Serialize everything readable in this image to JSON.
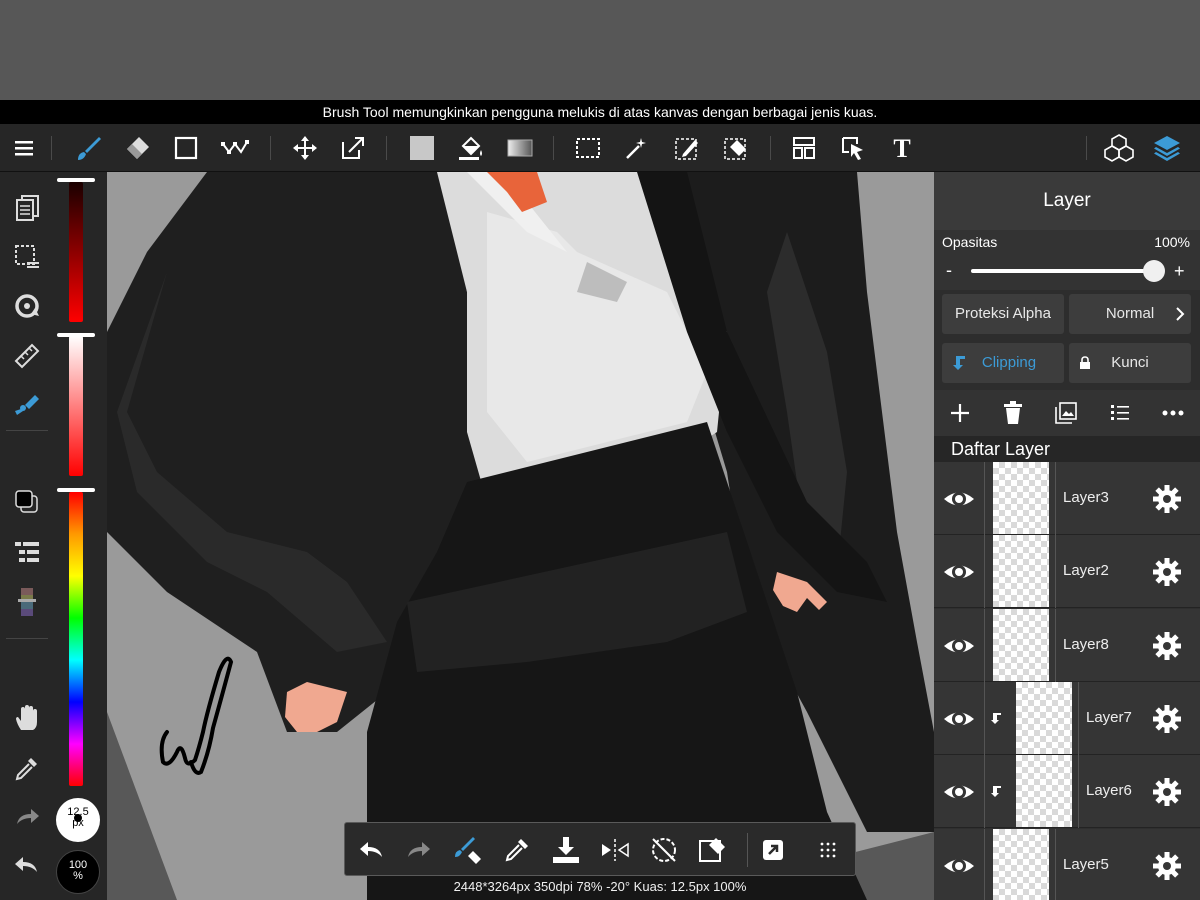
{
  "caption": "Brush Tool memungkinkan pengguna melukis di atas kanvas dengan berbagai jenis kuas.",
  "toolbar": {
    "tools": [
      "menu-icon",
      "brush-icon",
      "eraser-icon",
      "select-rect-icon",
      "lasso-icon",
      "move-icon",
      "transform-icon",
      "fill-color-icon",
      "bucket-icon",
      "gradient-icon",
      "marquee-icon",
      "magic-wand-icon",
      "select-pen-icon",
      "select-eraser-icon",
      "layout-icon",
      "select-layer-icon",
      "text-icon",
      "materials-icon",
      "layers-icon"
    ]
  },
  "brush_size": {
    "value": "12.5",
    "unit": "px"
  },
  "brush_opacity": {
    "value": "100",
    "unit": "%"
  },
  "colors": {
    "accent": "#3c9bd6",
    "primary": "#000000"
  },
  "layer_panel": {
    "title": "Layer",
    "opacity_label": "Opasitas",
    "opacity_value": "100%",
    "opacity_fraction": 1.0,
    "minus": "-",
    "plus": "+",
    "protect_alpha": "Proteksi Alpha",
    "blend_mode": "Normal",
    "clipping": "Clipping",
    "lock": "Kunci",
    "list_title": "Daftar Layer",
    "layers": [
      {
        "name": "Layer3",
        "clipped": false
      },
      {
        "name": "Layer2",
        "clipped": false
      },
      {
        "name": "Layer8",
        "clipped": false
      },
      {
        "name": "Layer7",
        "clipped": true
      },
      {
        "name": "Layer6",
        "clipped": true
      },
      {
        "name": "Layer5",
        "clipped": false
      }
    ]
  },
  "status": "2448*3264px 350dpi 78% -20° Kuas: 12.5px 100%"
}
